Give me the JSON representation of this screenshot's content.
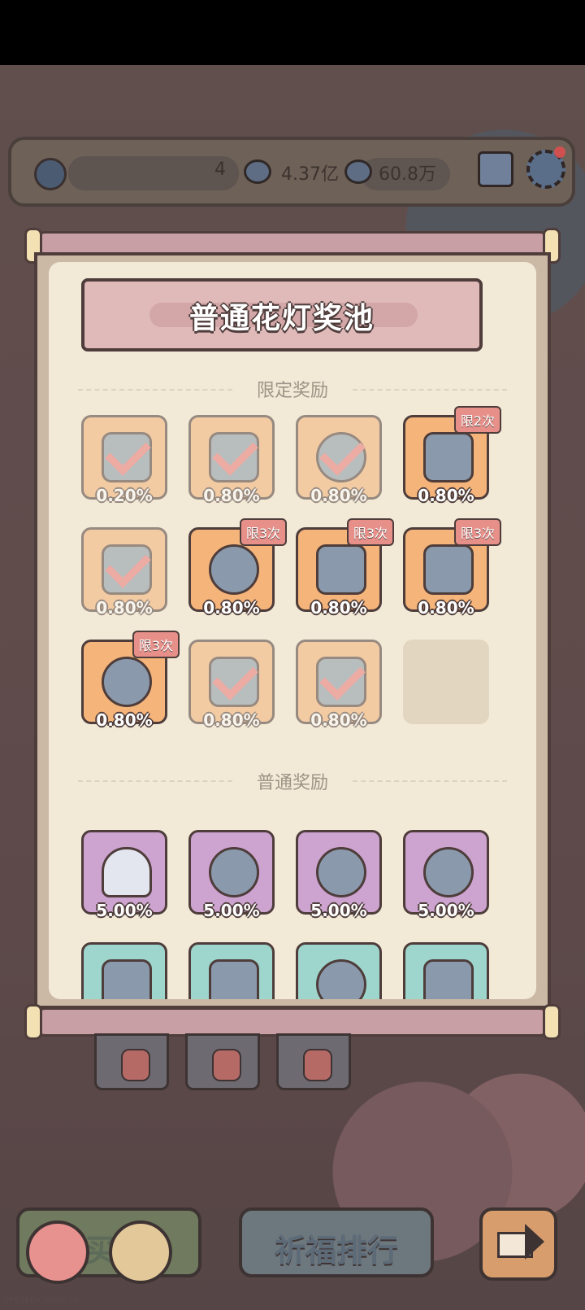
{
  "hud": {
    "level": "4",
    "currency1": "4.37亿",
    "currency2": "60.8万",
    "icons": [
      "clover-icon",
      "bubble-icon",
      "bubble-icon",
      "mail-icon",
      "gear-icon"
    ]
  },
  "panel": {
    "title": "普通花灯奖池",
    "limited_section": "限定奖励",
    "normal_section": "普通奖励"
  },
  "limited_rewards": [
    {
      "pct": "0.20%",
      "claimed": true,
      "limit": ""
    },
    {
      "pct": "0.80%",
      "claimed": true,
      "limit": ""
    },
    {
      "pct": "0.80%",
      "claimed": true,
      "limit": ""
    },
    {
      "pct": "0.80%",
      "claimed": false,
      "limit": "限2次"
    },
    {
      "pct": "0.80%",
      "claimed": true,
      "limit": ""
    },
    {
      "pct": "0.80%",
      "claimed": false,
      "limit": "限3次"
    },
    {
      "pct": "0.80%",
      "claimed": false,
      "limit": "限3次"
    },
    {
      "pct": "0.80%",
      "claimed": false,
      "limit": "限3次"
    },
    {
      "pct": "0.80%",
      "claimed": false,
      "limit": "限3次"
    },
    {
      "pct": "0.80%",
      "claimed": true,
      "limit": ""
    },
    {
      "pct": "0.80%",
      "claimed": true,
      "limit": ""
    }
  ],
  "normal_rewards": [
    {
      "pct": "5.00%"
    },
    {
      "pct": "5.00%"
    },
    {
      "pct": "5.00%"
    },
    {
      "pct": "5.00%"
    }
  ],
  "bottom": {
    "mid_button": "祈福排行",
    "left_button_partial": "买",
    "id_code": "3Y9ZFDX30HH550"
  },
  "colors": {
    "limited_bg": "#f5b47a",
    "normal_bg": "#cda3d0",
    "teal_bg": "#9ed5cc",
    "panel_bg": "#f2e9d6"
  }
}
